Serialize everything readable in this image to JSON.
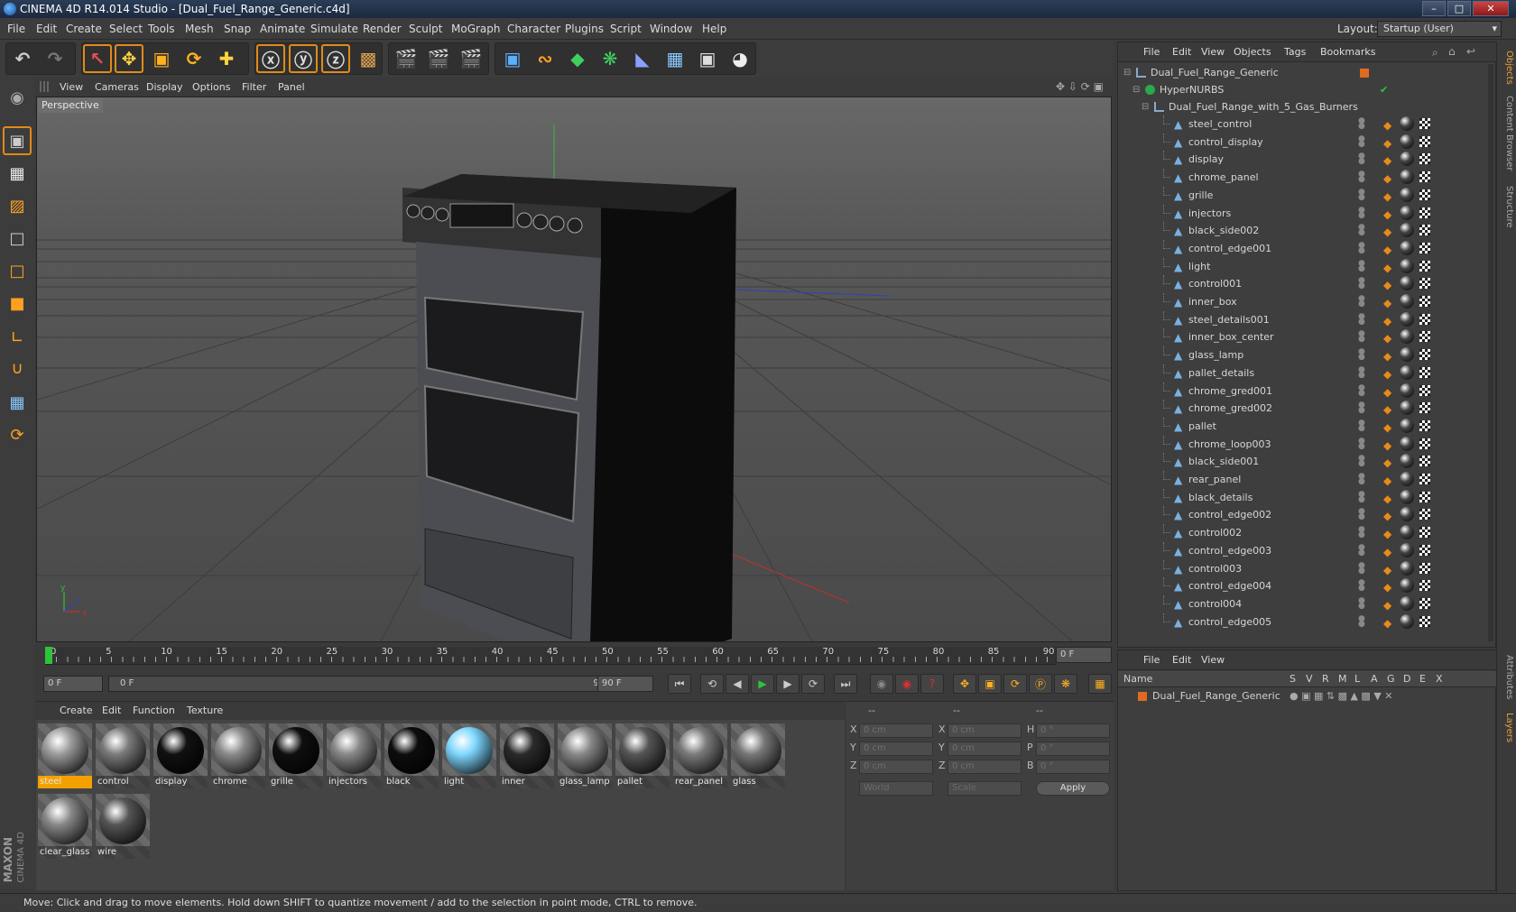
{
  "window": {
    "title": "CINEMA 4D R14.014 Studio - [Dual_Fuel_Range_Generic.c4d]"
  },
  "menubar": {
    "items": [
      "File",
      "Edit",
      "Create",
      "Select",
      "Tools",
      "Mesh",
      "Snap",
      "Animate",
      "Simulate",
      "Render",
      "Sculpt",
      "MoGraph",
      "Character",
      "Plugins",
      "Script",
      "Window",
      "Help"
    ],
    "layout_label": "Layout:",
    "layout_value": "Startup (User)"
  },
  "viewport": {
    "menu": [
      "View",
      "Cameras",
      "Display",
      "Options",
      "Filter",
      "Panel"
    ],
    "label": "Perspective",
    "axis": {
      "x": "x",
      "y": "y",
      "z": "z"
    }
  },
  "timeline": {
    "ticks": [
      "0",
      "5",
      "10",
      "15",
      "20",
      "25",
      "30",
      "35",
      "40",
      "45",
      "50",
      "55",
      "60",
      "65",
      "70",
      "75",
      "80",
      "85",
      "90"
    ],
    "end_frame_display": "0 F",
    "current_frame": "0 F",
    "range_start": "0 F",
    "range_end": "90 F",
    "max_frame": "90 F"
  },
  "materials": {
    "menu": [
      "Create",
      "Edit",
      "Function",
      "Texture"
    ],
    "items": [
      {
        "name": "steel",
        "color": "#9a9a9a",
        "selected": true
      },
      {
        "name": "control",
        "color": "#7a7a7a"
      },
      {
        "name": "display",
        "color": "#111111"
      },
      {
        "name": "chrome",
        "color": "#8a8a8a"
      },
      {
        "name": "grille",
        "color": "#0f0f0f"
      },
      {
        "name": "injectors",
        "color": "#888888"
      },
      {
        "name": "black",
        "color": "#0d0d0d"
      },
      {
        "name": "light",
        "color": "#7fd8ff"
      },
      {
        "name": "inner",
        "color": "#2a2a2a"
      },
      {
        "name": "glass_lamp",
        "color": "#888888"
      },
      {
        "name": "pallet",
        "color": "#555555"
      },
      {
        "name": "rear_panel",
        "color": "#7a7a7a"
      },
      {
        "name": "glass",
        "color": "#777777"
      },
      {
        "name": "clear_glass",
        "color": "#888888"
      },
      {
        "name": "wire",
        "color": "#555555"
      }
    ]
  },
  "coords": {
    "headers": [
      "--",
      "--",
      "--"
    ],
    "rows": [
      {
        "a_label": "X",
        "a": "0 cm",
        "b_label": "X",
        "b": "0 cm",
        "c_label": "H",
        "c": "0 °"
      },
      {
        "a_label": "Y",
        "a": "0 cm",
        "b_label": "Y",
        "b": "0 cm",
        "c_label": "P",
        "c": "0 °"
      },
      {
        "a_label": "Z",
        "a": "0 cm",
        "b_label": "Z",
        "b": "0 cm",
        "c_label": "B",
        "c": "0 °"
      }
    ],
    "mode": "World",
    "scale": "Scale",
    "apply": "Apply"
  },
  "objects": {
    "menu": [
      "File",
      "Edit",
      "View",
      "Objects",
      "Tags",
      "Bookmarks"
    ],
    "root": "Dual_Fuel_Range_Generic",
    "hypernurbs": "HyperNURBS",
    "group": "Dual_Fuel_Range_with_5_Gas_Burners",
    "children": [
      "steel_control",
      "control_display",
      "display",
      "chrome_panel",
      "grille",
      "injectors",
      "black_side002",
      "control_edge001",
      "light",
      "control001",
      "inner_box",
      "steel_details001",
      "inner_box_center",
      "glass_lamp",
      "pallet_details",
      "chrome_gred001",
      "chrome_gred002",
      "pallet",
      "chrome_loop003",
      "black_side001",
      "rear_panel",
      "black_details",
      "control_edge002",
      "control002",
      "control_edge003",
      "control003",
      "control_edge004",
      "control004",
      "control_edge005"
    ]
  },
  "layers": {
    "menu": [
      "File",
      "Edit",
      "View"
    ],
    "columns": [
      "Name",
      "S",
      "V",
      "R",
      "M",
      "L",
      "A",
      "G",
      "D",
      "E",
      "X"
    ],
    "rows": [
      "Dual_Fuel_Range_Generic"
    ]
  },
  "side_tabs": [
    "Objects",
    "Content Browser",
    "Structure",
    "Attributes",
    "Layers"
  ],
  "status": "Move: Click and drag to move elements. Hold down SHIFT to quantize movement / add to the selection in point mode, CTRL to remove.",
  "brand": {
    "line1": "MAXON",
    "line2": "CINEMA 4D"
  },
  "colors": {
    "accent": "#e88a1a",
    "selection": "#f4a100",
    "axis_x": "#c03030",
    "axis_y": "#30c030",
    "axis_z": "#3040c0"
  }
}
